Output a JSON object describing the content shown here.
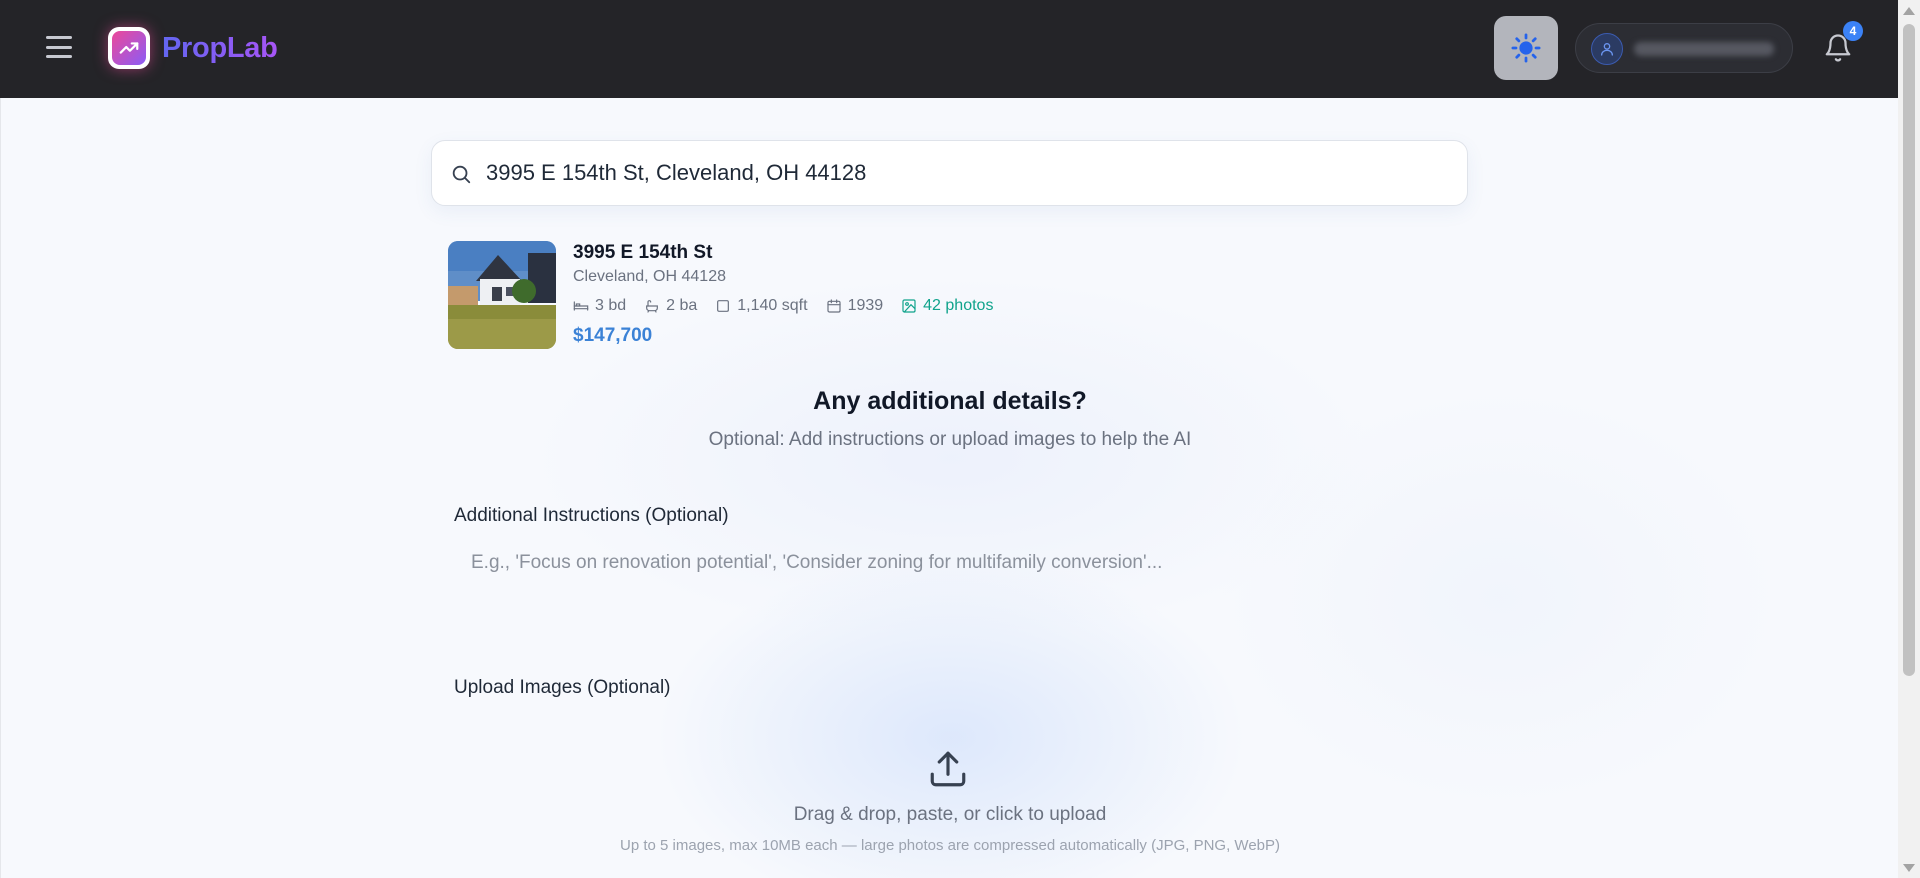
{
  "app": {
    "name": "PropLab",
    "notification_count": "4"
  },
  "search": {
    "value": "3995 E 154th St, Cleveland, OH 44128"
  },
  "property": {
    "street": "3995 E 154th St",
    "city_state_zip": "Cleveland, OH 44128",
    "beds": "3 bd",
    "baths": "2 ba",
    "sqft": "1,140 sqft",
    "year_built": "1939",
    "photos": "42 photos",
    "price": "$147,700"
  },
  "details": {
    "heading": "Any additional details?",
    "subheading": "Optional: Add instructions or upload images to help the AI",
    "instructions_label": "Additional Instructions (Optional)",
    "instructions_placeholder": "E.g., 'Focus on renovation potential', 'Consider zoning for multifamily conversion'...",
    "upload_label": "Upload Images (Optional)",
    "drop_text": "Drag & drop, paste, or click to upload",
    "drop_hint": "Up to 5 images, max 10MB each — large photos are compressed automatically (JPG, PNG, WebP)"
  },
  "colors": {
    "topbar": "#242428",
    "accent_blue": "#3b82d6",
    "photos_green": "#10a38c",
    "brand_gradient_start": "#6366f1",
    "brand_gradient_end": "#a855f7"
  },
  "icons": {
    "menu": "hamburger-icon",
    "theme": "sun-icon",
    "user": "user-icon",
    "notifications": "bell-icon",
    "search": "search-icon",
    "upload": "upload-icon"
  }
}
